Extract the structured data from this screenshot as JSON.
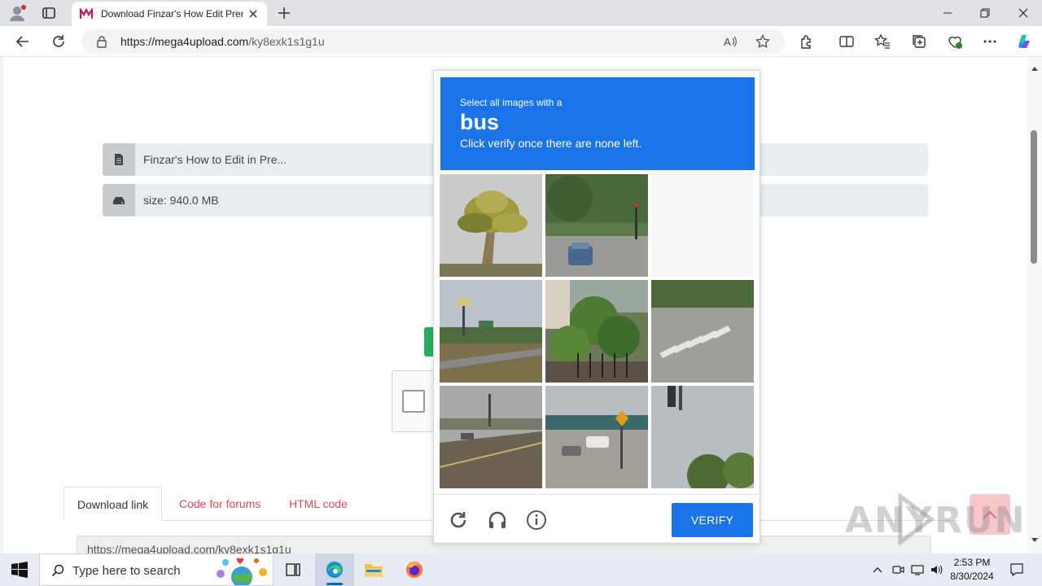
{
  "browser": {
    "tab_title": "Download Finzar's How Edit Pren",
    "url_domain": "https://mega4upload.com",
    "url_path": "/ky8exk1s1g1u",
    "accent": "#1a73e8"
  },
  "page": {
    "file_name": "Finzar's How to Edit in Pre...",
    "file_size": "size: 940.0 MB",
    "tabs": [
      "Download link",
      "Code for forums",
      "HTML code"
    ],
    "link_text": "https://mega4upload.com/ky8exk1s1g1u"
  },
  "captcha": {
    "instruction_line1": "Select all images with a",
    "target": "bus",
    "instruction_line2": "Click verify once there are none left.",
    "verify_label": "VERIFY",
    "tiles": [
      "palm-tree",
      "street-car",
      "blank",
      "highway-sign",
      "garden-plants",
      "crosswalk",
      "road-traffic",
      "parking-lot",
      "traffic-light"
    ]
  },
  "watermark": {
    "left": "ANY",
    "right": "RUN"
  },
  "taskbar": {
    "search_placeholder": "Type here to search",
    "time": "2:53 PM",
    "date": "8/30/2024"
  }
}
